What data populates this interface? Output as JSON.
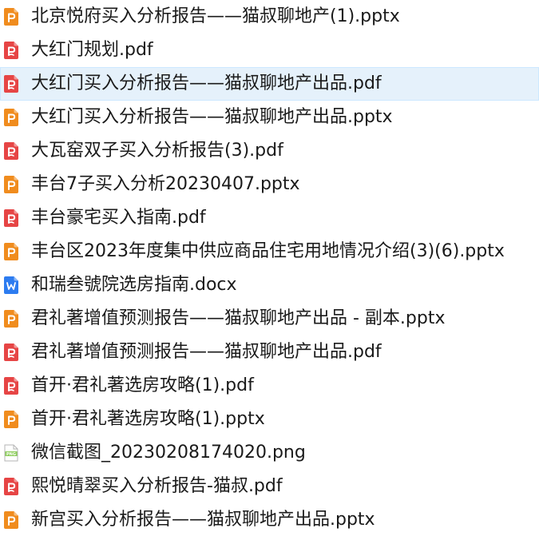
{
  "files": [
    {
      "name": "北京悦府买入分析报告——猫叔聊地产(1).pptx",
      "type": "pptx",
      "icon": "powerpoint-file-icon",
      "selected": false
    },
    {
      "name": "大红门规划.pdf",
      "type": "pdf",
      "icon": "pdf-file-icon",
      "selected": false
    },
    {
      "name": "大红门买入分析报告——猫叔聊地产出品.pdf",
      "type": "pdf",
      "icon": "pdf-file-icon",
      "selected": true
    },
    {
      "name": "大红门买入分析报告——猫叔聊地产出品.pptx",
      "type": "pptx",
      "icon": "powerpoint-file-icon",
      "selected": false
    },
    {
      "name": "大瓦窑双子买入分析报告(3).pdf",
      "type": "pdf",
      "icon": "pdf-file-icon",
      "selected": false
    },
    {
      "name": "丰台7子买入分析20230407.pptx",
      "type": "pptx",
      "icon": "powerpoint-file-icon",
      "selected": false
    },
    {
      "name": "丰台豪宅买入指南.pdf",
      "type": "pdf",
      "icon": "pdf-file-icon",
      "selected": false
    },
    {
      "name": "丰台区2023年度集中供应商品住宅用地情况介绍(3)(6).pptx",
      "type": "pptx",
      "icon": "powerpoint-file-icon",
      "selected": false
    },
    {
      "name": "和瑞叁號院选房指南.docx",
      "type": "docx",
      "icon": "word-file-icon",
      "selected": false
    },
    {
      "name": "君礼著增值预测报告——猫叔聊地产出品 - 副本.pptx",
      "type": "pptx",
      "icon": "powerpoint-file-icon",
      "selected": false
    },
    {
      "name": "君礼著增值预测报告——猫叔聊地产出品.pdf",
      "type": "pdf",
      "icon": "pdf-file-icon",
      "selected": false
    },
    {
      "name": "首开·君礼著选房攻略(1).pdf",
      "type": "pdf",
      "icon": "pdf-file-icon",
      "selected": false
    },
    {
      "name": "首开·君礼著选房攻略(1).pptx",
      "type": "pptx",
      "icon": "powerpoint-file-icon",
      "selected": false
    },
    {
      "name": "微信截图_20230208174020.png",
      "type": "png",
      "icon": "image-file-icon",
      "selected": false
    },
    {
      "name": "熙悦晴翠买入分析报告-猫叔.pdf",
      "type": "pdf",
      "icon": "pdf-file-icon",
      "selected": false
    },
    {
      "name": "新宫买入分析报告——猫叔聊地产出品.pptx",
      "type": "pptx",
      "icon": "powerpoint-file-icon",
      "selected": false
    }
  ],
  "colors": {
    "pptx": "#f08c1e",
    "pdf": "#e64545",
    "docx": "#2d7cf0",
    "png": "#8ccd5a",
    "selection_bg": "#e5f1fb",
    "selection_border": "#cce8ff",
    "text": "#1a1a1a"
  },
  "icon_letters": {
    "pptx": "P",
    "pdf": "P",
    "docx": "W",
    "png": "PNG"
  }
}
